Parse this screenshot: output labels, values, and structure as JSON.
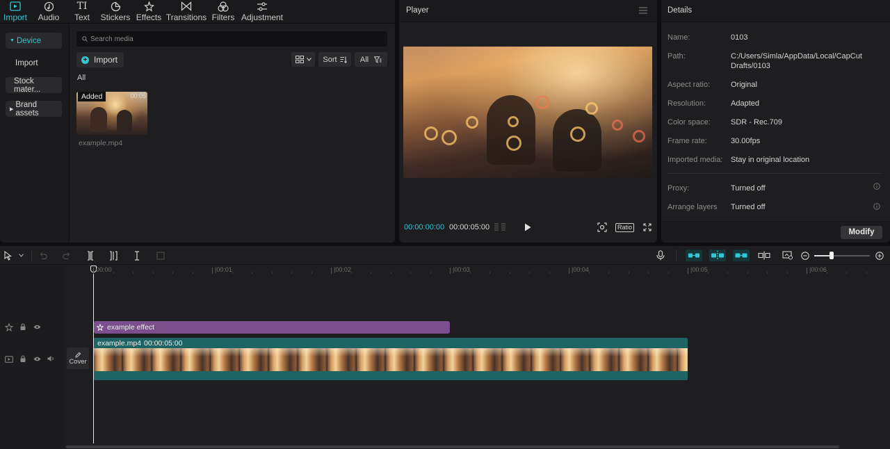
{
  "media_tabs": [
    {
      "label": "Import",
      "icon": "import-icon",
      "active": true
    },
    {
      "label": "Audio",
      "icon": "audio-icon"
    },
    {
      "label": "Text",
      "icon": "text-icon"
    },
    {
      "label": "Stickers",
      "icon": "stickers-icon"
    },
    {
      "label": "Effects",
      "icon": "effects-icon"
    },
    {
      "label": "Transitions",
      "icon": "transitions-icon"
    },
    {
      "label": "Filters",
      "icon": "filters-icon"
    },
    {
      "label": "Adjustment",
      "icon": "adjustment-icon"
    }
  ],
  "sidebar": {
    "device": "Device",
    "import": "Import",
    "stock": "Stock mater...",
    "brand": "Brand assets"
  },
  "media": {
    "search_placeholder": "Search media",
    "import_label": "Import",
    "sort_label": "Sort",
    "all_button": "All",
    "section_label": "All",
    "item": {
      "badge": "Added",
      "duration": "00:05",
      "name": "example.mp4"
    }
  },
  "player": {
    "title": "Player",
    "current_time": "00:00:00:00",
    "total_time": "00:00:05:00",
    "ratio_label": "Ratio"
  },
  "details": {
    "title": "Details",
    "rows": [
      {
        "label": "Name:",
        "value": "0103"
      },
      {
        "label": "Path:",
        "value": "C:/Users/Simla/AppData/Local/CapCut",
        "value2": "Drafts/0103"
      },
      {
        "label": "Aspect ratio:",
        "value": "Original"
      },
      {
        "label": "Resolution:",
        "value": "Adapted"
      },
      {
        "label": "Color space:",
        "value": "SDR - Rec.709"
      },
      {
        "label": "Frame rate:",
        "value": "30.00fps"
      },
      {
        "label": "Imported media:",
        "value": "Stay in original location"
      },
      {
        "label": "Proxy:",
        "value": "Turned off"
      },
      {
        "label": "Arrange layers",
        "value": "Turned off"
      }
    ],
    "modify_label": "Modify"
  },
  "timeline": {
    "ruler": [
      "00:00",
      "|00:01",
      "|00:02",
      "|00:03",
      "|00:04",
      "|00:05",
      "|00:06"
    ],
    "effect_clip": "example effect",
    "video_clip": {
      "name": "example.mp4",
      "duration": "00:00:05:00"
    },
    "cover_label": "Cover",
    "zoom_level": 0.3
  },
  "colors": {
    "accent": "#2fc7d3",
    "effect_clip": "#7a4f8c",
    "video_clip": "#1f6465"
  }
}
